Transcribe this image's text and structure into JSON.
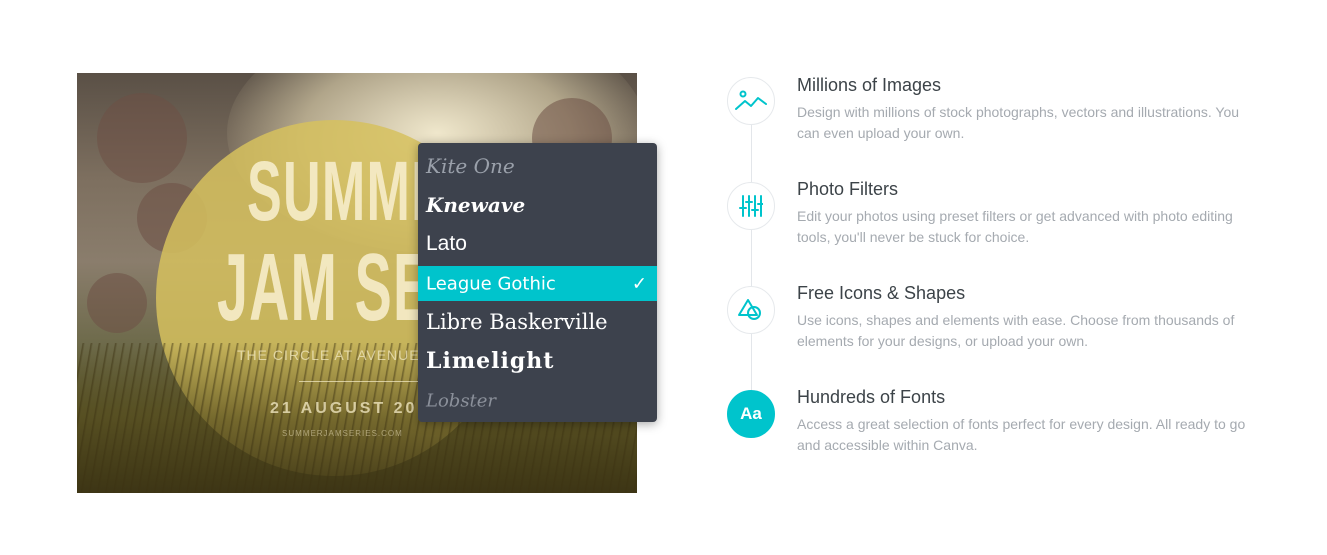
{
  "poster": {
    "title_line1": "SUMMER",
    "title_line2": "JAM SE",
    "venue": "THE CIRCLE AT AVENUE",
    "date": "21 AUGUST 20",
    "website": "SUMMERJAMSERIES.COM"
  },
  "font_menu": {
    "items": [
      {
        "label": "Kite One"
      },
      {
        "label": "Knewave"
      },
      {
        "label": "Lato"
      },
      {
        "label": "League Gothic",
        "selected": true
      },
      {
        "label": "Libre Baskerville"
      },
      {
        "label": "Limelight"
      },
      {
        "label": "Lobster"
      }
    ],
    "check_glyph": "✓",
    "selected_color": "#00c4cc",
    "background_color": "#3d424d"
  },
  "features": [
    {
      "icon": "image-chart-icon",
      "title": "Millions of Images",
      "description": "Design with millions of stock photographs, vectors and illustrations. You can even upload your own."
    },
    {
      "icon": "sliders-icon",
      "title": "Photo Filters",
      "description": "Edit your photos using preset filters or get advanced with photo editing tools, you'll never be stuck for choice."
    },
    {
      "icon": "shapes-icon",
      "title": "Free Icons & Shapes",
      "description": "Use icons, shapes and elements with ease. Choose from thousands of elements for your designs, or upload your own."
    },
    {
      "icon": "font-icon",
      "icon_text": "Aa",
      "title": "Hundreds of Fonts",
      "description": "Access a great selection of fonts perfect for every design. All ready to go and accessible within Canva.",
      "active": true
    }
  ],
  "colors": {
    "accent": "#00c4cc",
    "title_text": "#3c4348",
    "body_text": "#a5aab0"
  }
}
